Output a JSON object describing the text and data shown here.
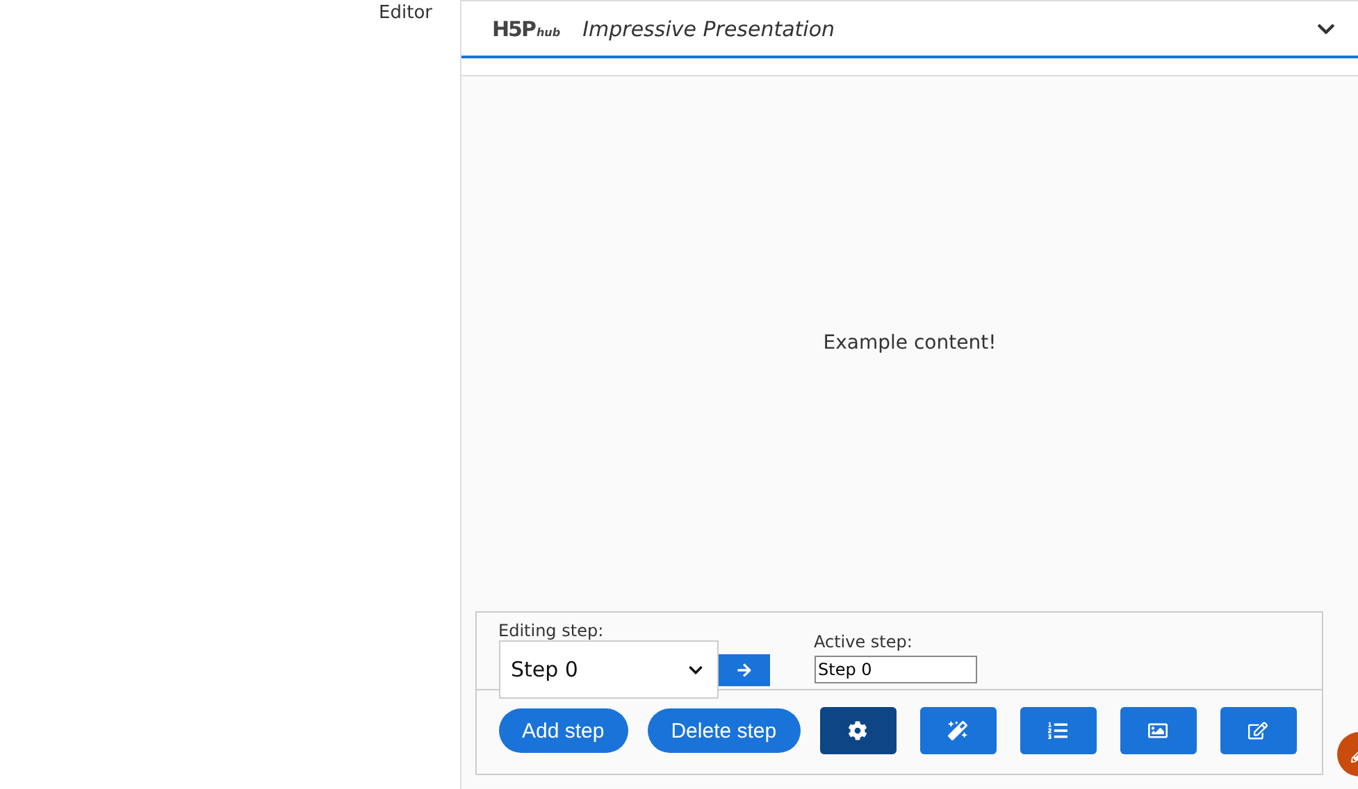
{
  "sidebar": {
    "label": "Editor"
  },
  "header": {
    "logo_text": "H5P",
    "logo_sub": "hub",
    "title": "Impressive Presentation"
  },
  "canvas": {
    "content": "Example content!"
  },
  "step_bar": {
    "editing_label": "Editing step:",
    "editing_value": "Step 0",
    "active_label": "Active step:",
    "active_value": "Step 0"
  },
  "actions": [
    {
      "label": "Add step"
    },
    {
      "label": "Delete step"
    }
  ],
  "tools": [
    {
      "kind": "settings",
      "selected": true
    },
    {
      "kind": "magic",
      "selected": false
    },
    {
      "kind": "list",
      "selected": false
    },
    {
      "kind": "image",
      "selected": false
    },
    {
      "kind": "edit",
      "selected": false
    }
  ]
}
